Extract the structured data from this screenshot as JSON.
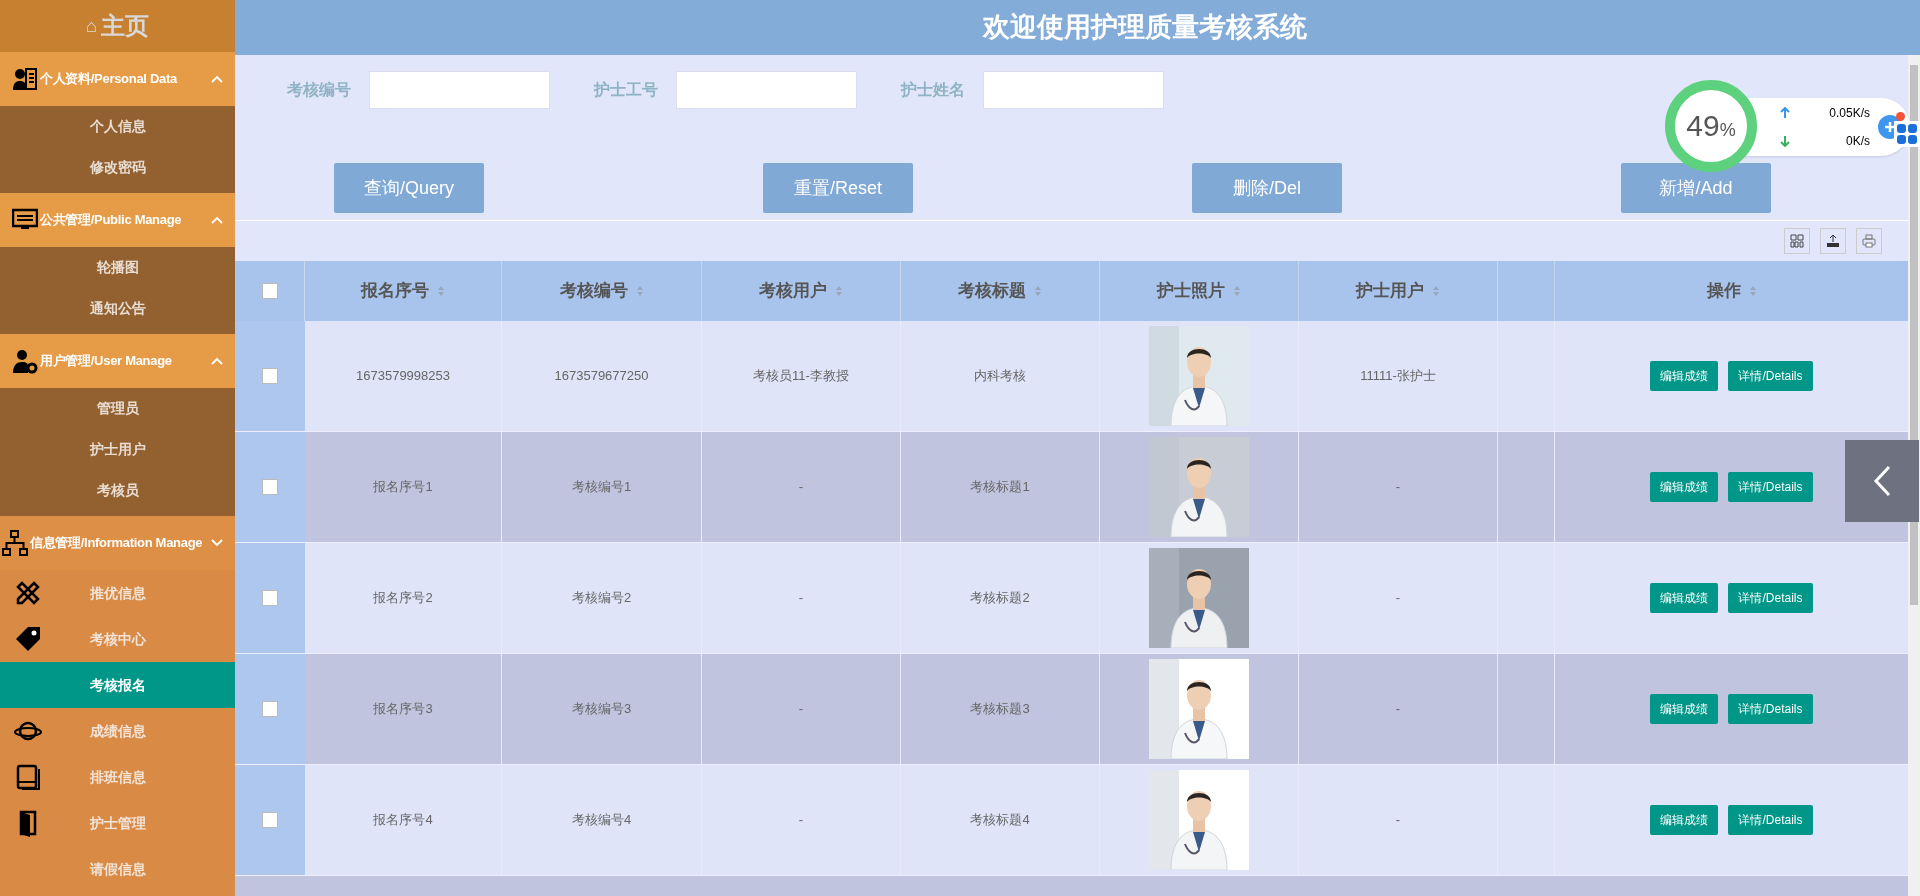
{
  "sidebar": {
    "home": {
      "glyph": "⌂",
      "label": "主页"
    },
    "groups": [
      {
        "label": "个人资料/Personal Data",
        "expanded": true,
        "items": [
          {
            "label": "个人信息",
            "selected": false
          },
          {
            "label": "修改密码",
            "selected": false
          }
        ]
      },
      {
        "label": "公共管理/Public Manage",
        "expanded": true,
        "items": [
          {
            "label": "轮播图",
            "selected": false
          },
          {
            "label": "通知公告",
            "selected": false
          }
        ]
      },
      {
        "label": "用户管理/User Manage",
        "expanded": true,
        "items": [
          {
            "label": "管理员",
            "selected": false
          },
          {
            "label": "护士用户",
            "selected": false
          },
          {
            "label": "考核员",
            "selected": false
          }
        ]
      },
      {
        "label": "信息管理/Information Manage",
        "expanded": false,
        "items": [
          {
            "label": "推优信息",
            "selected": false
          },
          {
            "label": "考核中心",
            "selected": false
          },
          {
            "label": "考核报名",
            "selected": true
          },
          {
            "label": "成绩信息",
            "selected": false
          },
          {
            "label": "排班信息",
            "selected": false
          },
          {
            "label": "护士管理",
            "selected": false
          },
          {
            "label": "请假信息",
            "selected": false
          }
        ]
      }
    ]
  },
  "header": {
    "title": "欢迎使用护理质量考核系统"
  },
  "filters": [
    {
      "label": "考核编号"
    },
    {
      "label": "护士工号"
    },
    {
      "label": "护士姓名"
    }
  ],
  "buttons": [
    "查询/Query",
    "重置/Reset",
    "删除/Del",
    "新增/Add"
  ],
  "table": {
    "select_all": false,
    "columns": [
      {
        "label": "报名序号",
        "sortable": true
      },
      {
        "label": "考核编号",
        "sortable": true
      },
      {
        "label": "考核用户",
        "sortable": true
      },
      {
        "label": "考核标题",
        "sortable": true
      },
      {
        "label": "护士照片",
        "sortable": true
      },
      {
        "label": "护士用户",
        "sortable": true
      },
      {
        "label": "操作",
        "sortable": true
      }
    ],
    "rows": [
      {
        "checked": false,
        "cells": [
          "1673579998253",
          "1673579677250",
          "考核员11-李教授",
          "内科考核",
          "11111-张护士"
        ],
        "actions": [
          "编辑成绩",
          "详情/Details"
        ]
      },
      {
        "checked": false,
        "cells": [
          "报名序号1",
          "考核编号1",
          "-",
          "考核标题1",
          "-"
        ],
        "actions": [
          "编辑成绩",
          "详情/Details"
        ]
      },
      {
        "checked": false,
        "cells": [
          "报名序号2",
          "考核编号2",
          "-",
          "考核标题2",
          "-"
        ],
        "actions": [
          "编辑成绩",
          "详情/Details"
        ]
      },
      {
        "checked": false,
        "cells": [
          "报名序号3",
          "考核编号3",
          "-",
          "考核标题3",
          "-"
        ],
        "actions": [
          "编辑成绩",
          "详情/Details"
        ]
      },
      {
        "checked": false,
        "cells": [
          "报名序号4",
          "考核编号4",
          "-",
          "考核标题4",
          "-"
        ],
        "actions": [
          "编辑成绩",
          "详情/Details"
        ]
      }
    ]
  },
  "net_widget": {
    "percent": "49",
    "unit": "%",
    "up": "0.05K/s",
    "down": "0K/s"
  }
}
